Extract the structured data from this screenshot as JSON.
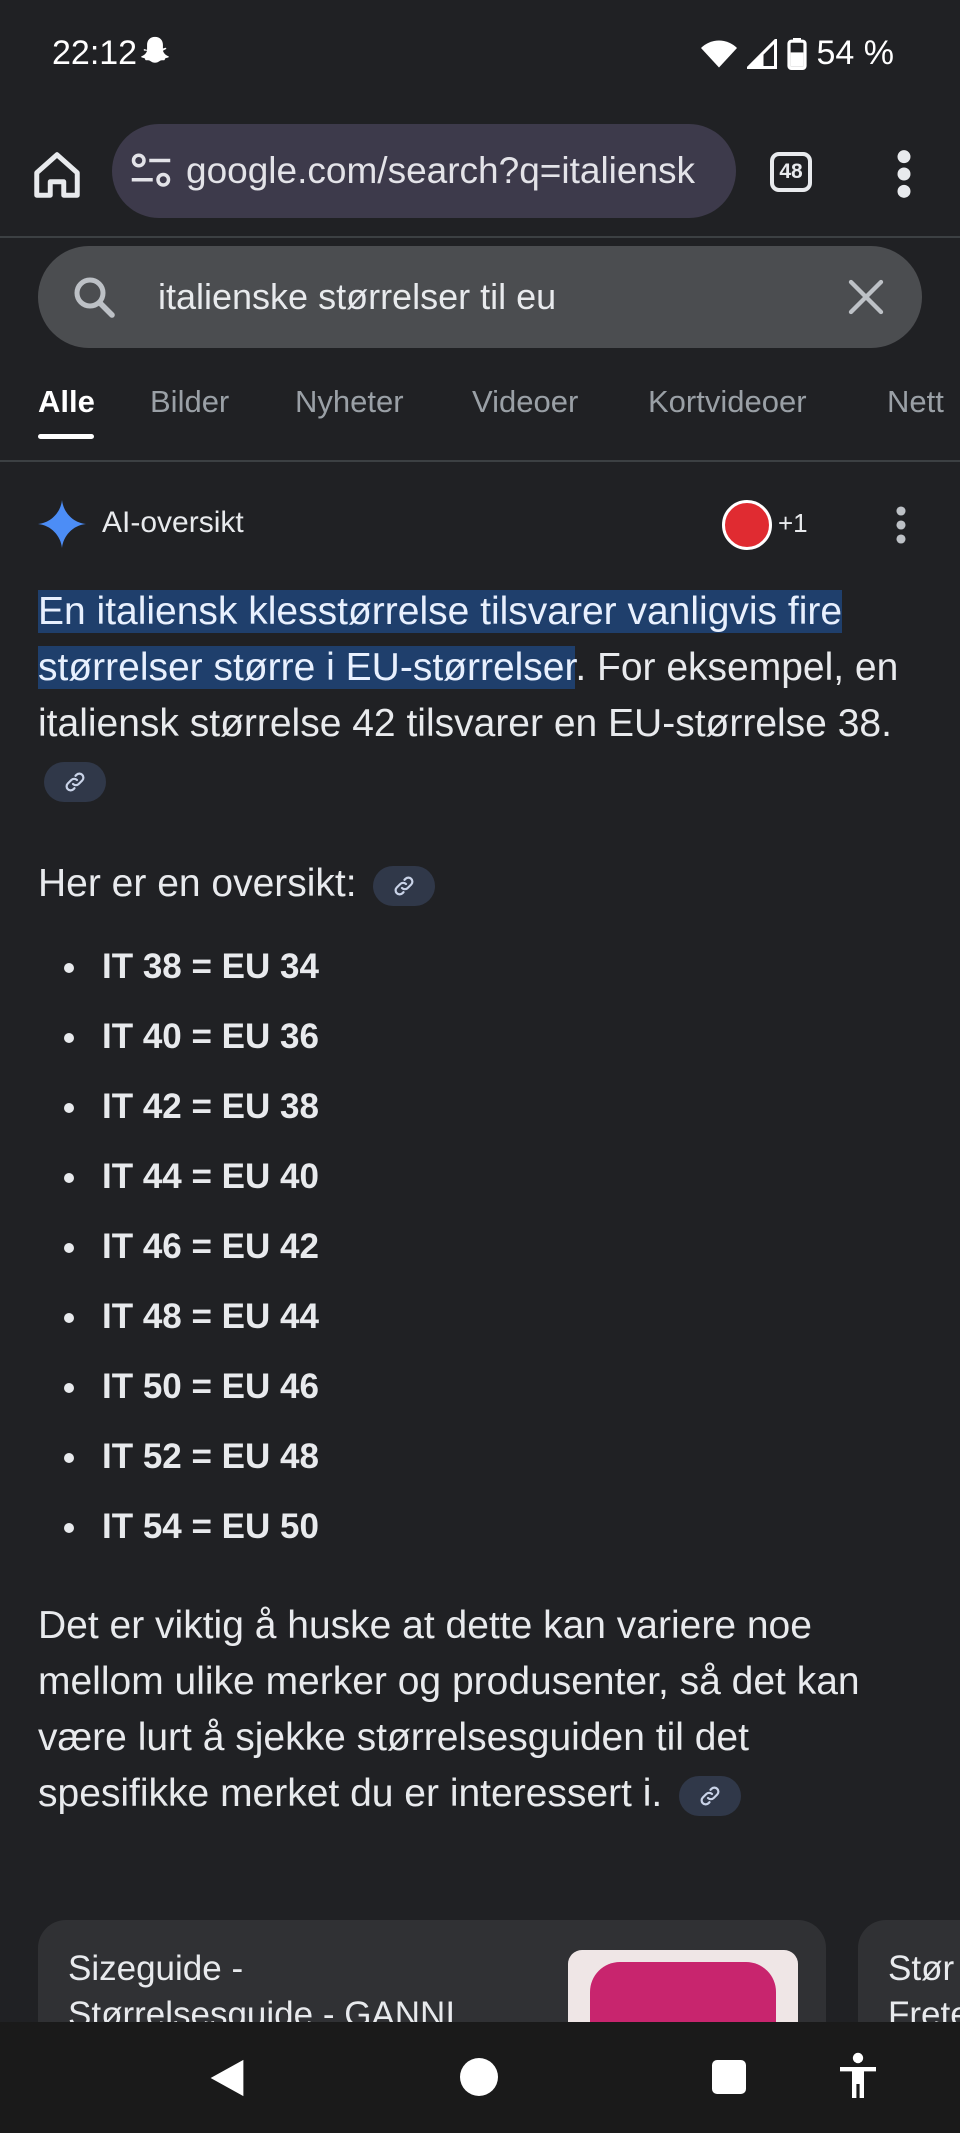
{
  "status_bar": {
    "time": "22:12",
    "battery": "54 %",
    "icons": [
      "snapchat-ghost-icon",
      "wifi-icon",
      "signal-icon",
      "battery-icon"
    ]
  },
  "browser": {
    "url": "google.com/search?q=italiensk",
    "tab_count": "48"
  },
  "search": {
    "query": "italienske størrelser til eu"
  },
  "tabs": [
    "Alle",
    "Bilder",
    "Nyheter",
    "Videoer",
    "Kortvideoer",
    "Nett"
  ],
  "ai": {
    "title": "AI-oversikt",
    "source_more": "+1",
    "highlight": "En italiensk klesstørrelse tilsvarer vanligvis fire størrelser større i EU-størrelser",
    "summary_rest": ". For eksempel, en italiensk størrelse 42 tilsvarer en EU-størrelse 38.",
    "overview_heading": "Her er en oversikt:",
    "sizes": [
      "IT 38 = EU 34",
      "IT 40 = EU 36",
      "IT 42 = EU 38",
      "IT 44 = EU 40",
      "IT 46 = EU 42",
      "IT 48 = EU 44",
      "IT 50 = EU 46",
      "IT 52 = EU 48",
      "IT 54 = EU 50"
    ],
    "note": "Det er viktig å huske at dette kan variere noe mellom ulike merker og produsenter, så det kan være lurt å sjekke størrelsesguiden til det spesifikke merket du er interessert i."
  },
  "cards": [
    {
      "line1": "Sizeguide -",
      "line2": "Størrelsesguide - GANNI"
    },
    {
      "line1": "Stør",
      "line2": "Frete"
    }
  ],
  "colors": {
    "background": "#202124",
    "highlight": "#1f3f6c",
    "omnibox": "#3d3a4b",
    "searchbox": "#4b4d50",
    "accent_spark": "#4c8df6"
  }
}
